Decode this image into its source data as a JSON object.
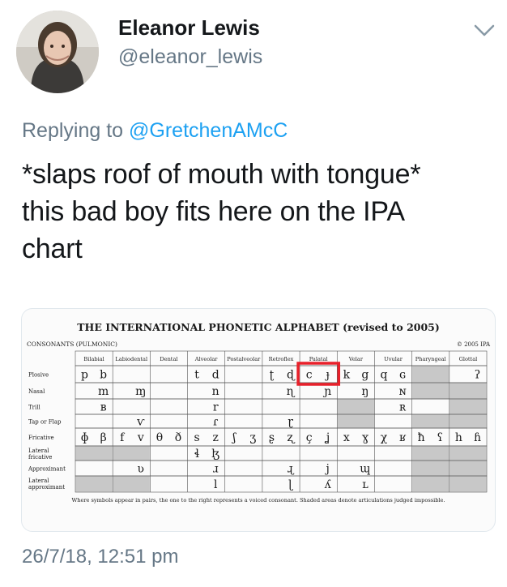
{
  "author": {
    "display_name": "Eleanor Lewis",
    "handle": "@eleanor_lewis",
    "avatar_icon": "profile-photo",
    "menu_icon": "chevron-down-icon"
  },
  "reply": {
    "prefix": "Replying to ",
    "mention": "@GretchenAMcC"
  },
  "tweet": {
    "lines": [
      "*slaps roof of mouth with tongue*",
      "this bad boy fits here on the IPA",
      "chart"
    ]
  },
  "ipa": {
    "title": "THE INTERNATIONAL PHONETIC ALPHABET (revised to 2005)",
    "section": "CONSONANTS (PULMONIC)",
    "copyright": "© 2005 IPA",
    "columns": [
      "Bilabial",
      "Labiodental",
      "Dental",
      "Alveolar",
      "Postalveolar",
      "Retroflex",
      "Palatal",
      "Velar",
      "Uvular",
      "Pharyngeal",
      "Glottal"
    ],
    "rows": [
      {
        "label": "Plosive",
        "cells": [
          "p b",
          "",
          "",
          "t d",
          "",
          "ʈ ɖ",
          "c ɟ",
          "k g",
          "q ɢ",
          "",
          "ʔ"
        ]
      },
      {
        "label": "Nasal",
        "cells": [
          "m",
          "ɱ",
          "",
          "n",
          "",
          "ɳ",
          "ɲ",
          "ŋ",
          "ɴ",
          "",
          ""
        ]
      },
      {
        "label": "Trill",
        "cells": [
          "ʙ",
          "",
          "",
          "r",
          "",
          "",
          "",
          "",
          "ʀ",
          "",
          ""
        ]
      },
      {
        "label": "Tap or Flap",
        "cells": [
          "",
          "ⱱ",
          "",
          "ɾ",
          "",
          "ɽ",
          "",
          "",
          "",
          "",
          ""
        ]
      },
      {
        "label": "Fricative",
        "cells": [
          "ɸ β",
          "f v",
          "θ ð",
          "s z",
          "ʃ ʒ",
          "ʂ ʐ",
          "ç ʝ",
          "x ɣ",
          "χ ʁ",
          "ħ ʕ",
          "h ɦ"
        ]
      },
      {
        "label": "Lateral fricative",
        "cells": [
          "",
          "",
          "",
          "ɬ ɮ",
          "",
          "",
          "",
          "",
          "",
          "",
          ""
        ]
      },
      {
        "label": "Approximant",
        "cells": [
          "",
          "ʋ",
          "",
          "ɹ",
          "",
          "ɻ",
          "j",
          "ɰ",
          "",
          "",
          ""
        ]
      },
      {
        "label": "Lateral approximant",
        "cells": [
          "",
          "",
          "",
          "l",
          "",
          "ɭ",
          "ʎ",
          "ʟ",
          "",
          "",
          ""
        ]
      }
    ],
    "footnote": "Where symbols appear in pairs, the one to the right represents a voiced consonant. Shaded areas denote articulations judged impossible.",
    "highlight_color": "#e8202a"
  },
  "timestamp": "26/7/18, 12:51 pm"
}
